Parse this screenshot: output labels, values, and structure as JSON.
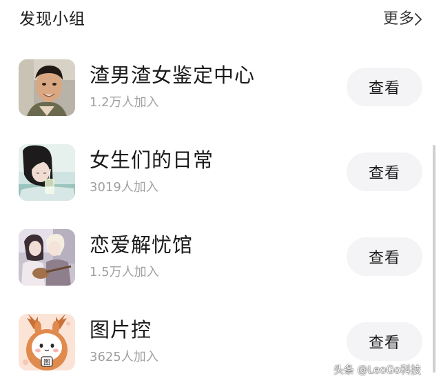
{
  "header": {
    "title": "发现小组",
    "more_label": "更多",
    "more_icon": "chevron-right-icon"
  },
  "groups": [
    {
      "name": "渣男渣女鉴定中心",
      "members": "1.2万人加入",
      "button_label": "查看",
      "avatar": "man-portrait-photo"
    },
    {
      "name": "女生们的日常",
      "members": "3019人加入",
      "button_label": "查看",
      "avatar": "girl-with-drink-photo"
    },
    {
      "name": "恋爱解忧馆",
      "members": "1.5万人加入",
      "button_label": "查看",
      "avatar": "couple-guitar-photo"
    },
    {
      "name": "图片控",
      "members": "3625人加入",
      "button_label": "查看",
      "avatar": "rabbit-deer-cartoon",
      "avatar_badge": "图"
    }
  ],
  "watermark": "头条 @LeoGo科技",
  "colors": {
    "button_bg": "#f4f4f6",
    "subtext": "#a0a0a0",
    "text": "#1a1a1a"
  }
}
